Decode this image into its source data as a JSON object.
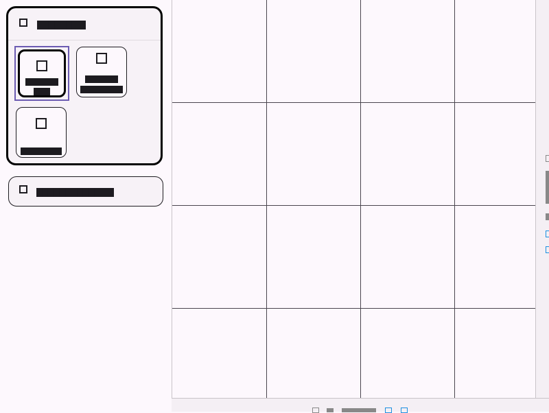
{
  "sidebar": {
    "group": {
      "title": "██████",
      "header_icon": "tool-icon",
      "chips": [
        {
          "label_line1": "████",
          "label_line2": "██",
          "icon": "tool-icon",
          "selected": true
        },
        {
          "label_line1": "████",
          "label_line2": "██_██",
          "icon": "tool-icon",
          "selected": false
        },
        {
          "label_line1": "█████",
          "label_line2": "",
          "icon": "tool-icon",
          "selected": false
        }
      ]
    },
    "section_button": {
      "label": "██████████",
      "icon": "tool-icon"
    }
  },
  "canvas": {
    "grid": "4x4"
  },
  "colors": {
    "background": "#fdf8fd",
    "panel": "#f7f2f7",
    "selected_outline": "#6b5bb2",
    "grid_line": "#4a454e",
    "accent_blue": "#1a8fe0"
  }
}
